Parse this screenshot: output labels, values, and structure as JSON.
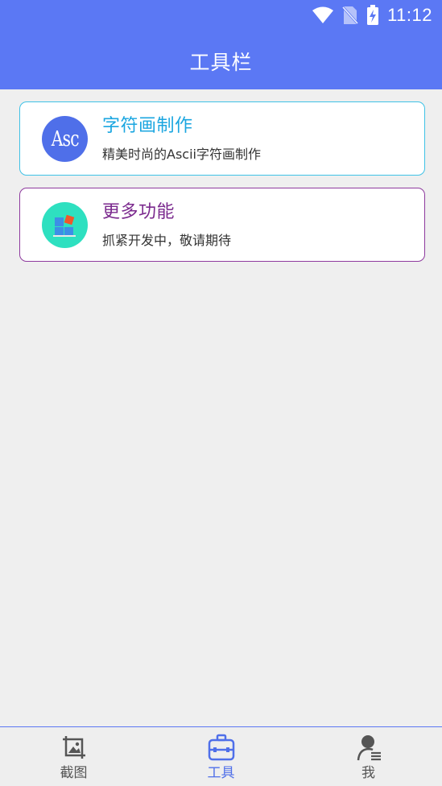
{
  "status_bar": {
    "time": "11:12",
    "icons": [
      "wifi-icon",
      "no-sim-icon",
      "battery-charging-icon"
    ]
  },
  "header": {
    "title": "工具栏",
    "background_color": "#5b78f4"
  },
  "cards": [
    {
      "title": "字符画制作",
      "subtitle": "精美时尚的Ascii字符画制作",
      "icon": "asc-icon",
      "icon_text": "Asc",
      "title_color": "#1ba6e0",
      "border_color": "#3fc2e6"
    },
    {
      "title": "更多功能",
      "subtitle": "抓紧开发中，敬请期待",
      "icon": "apps-icon",
      "title_color": "#7b2a8e",
      "border_color": "#8e3a9e"
    }
  ],
  "bottom_nav": {
    "items": [
      {
        "label": "截图",
        "icon": "crop-image-icon",
        "active": false
      },
      {
        "label": "工具",
        "icon": "toolbox-icon",
        "active": true
      },
      {
        "label": "我",
        "icon": "profile-icon",
        "active": false
      }
    ],
    "active_color": "#4f6fe9"
  }
}
